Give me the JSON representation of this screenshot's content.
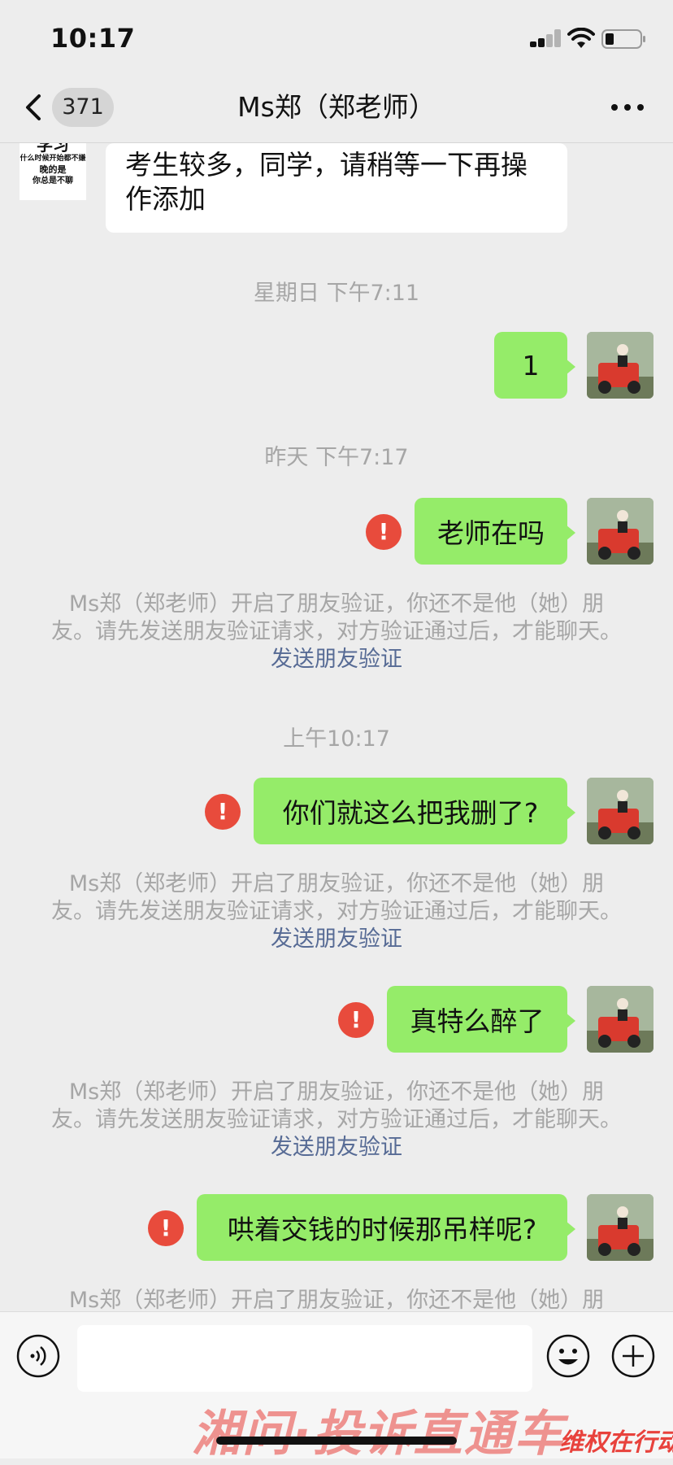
{
  "status_bar": {
    "time": "10:17"
  },
  "nav": {
    "unread_count": "371",
    "title": "Ms郑（郑老师）"
  },
  "messages": {
    "incoming_text": "考生较多，同学，请稍等一下再操作添加",
    "sender_avatar_text": [
      "学习",
      "什么时候开始都不嫌",
      "晚的是",
      "你总是不聊"
    ],
    "time_1": "星期日 下午7:11",
    "out_1": "1",
    "time_2": "昨天 下午7:17",
    "out_2": "老师在吗",
    "notice_1": "Ms郑（郑老师）开启了朋友验证，你还不是他（她）朋友。请先发送朋友验证请求，对方验证通过后，才能聊天。",
    "notice_link_1": "发送朋友验证",
    "time_3": "上午10:17",
    "out_3": "你们就这么把我删了?",
    "notice_2": "Ms郑（郑老师）开启了朋友验证，你还不是他（她）朋友。请先发送朋友验证请求，对方验证通过后，才能聊天。",
    "notice_link_2": "发送朋友验证",
    "out_4": "真特么醉了",
    "notice_3": "Ms郑（郑老师）开启了朋友验证，你还不是他（她）朋友。请先发送朋友验证请求，对方验证通过后，才能聊天。",
    "notice_link_3": "发送朋友验证",
    "out_5": "哄着交钱的时候那吊样呢?",
    "notice_4_partial": "Ms郑（郑老师）开启了朋友验证，你还不是他（她）朋",
    "error_glyph": "!"
  },
  "watermark": {
    "text": "湘问·投诉直通车",
    "stamp": "维权在行动"
  },
  "colors": {
    "outgoing_bubble": "#95ec69",
    "error": "#e84b3c",
    "link": "#576b95",
    "background": "#ededed"
  },
  "icons": [
    "back-arrow-icon",
    "more-dots-icon",
    "voice-icon",
    "emoji-icon",
    "add-icon",
    "error-icon",
    "signal-icon",
    "wifi-icon",
    "battery-icon"
  ]
}
